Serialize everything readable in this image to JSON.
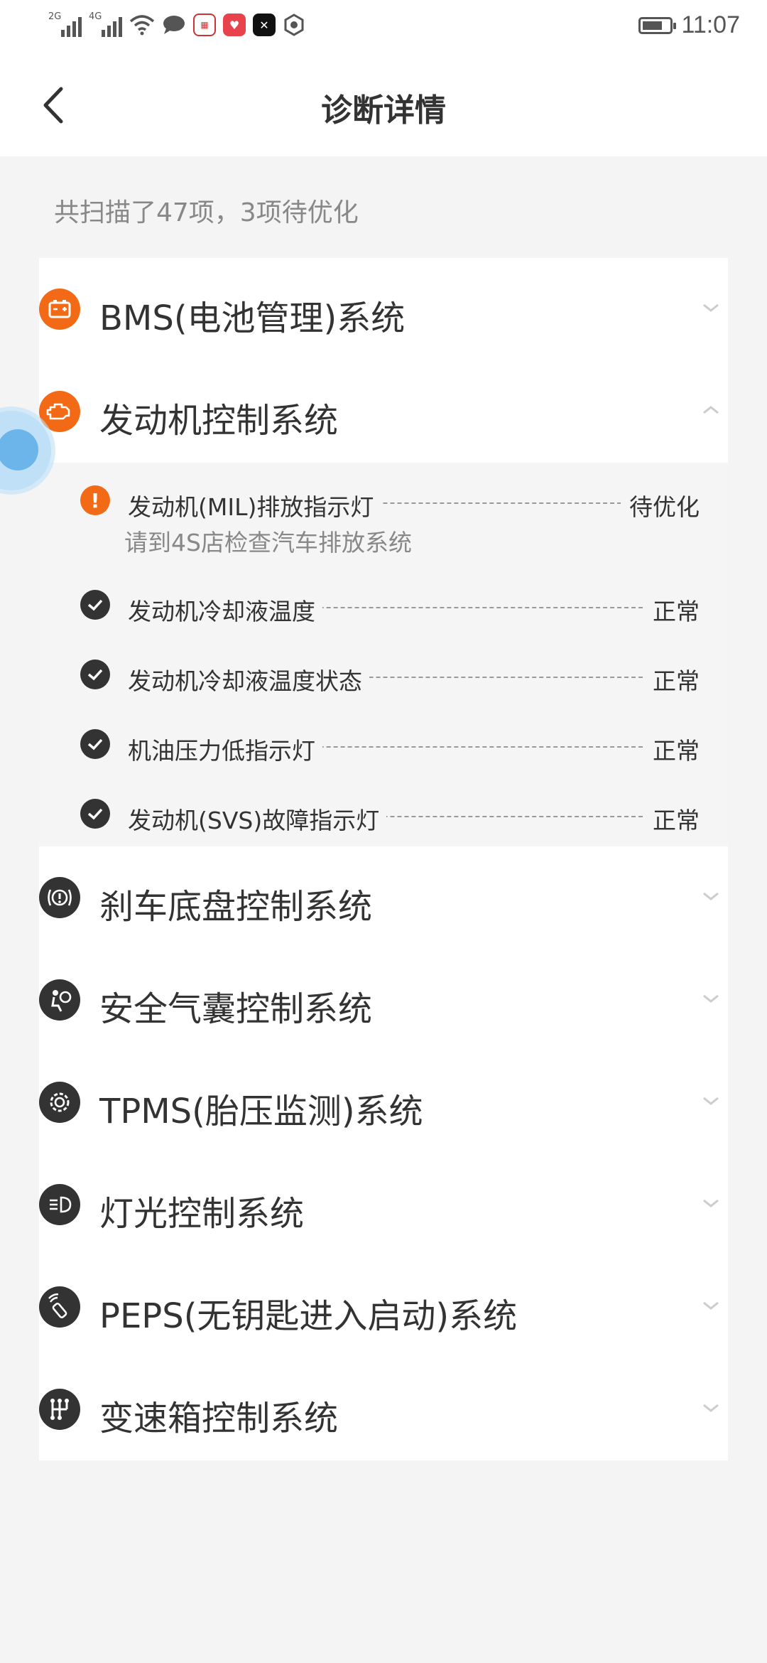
{
  "status_bar": {
    "net1": "2G",
    "net2": "4G",
    "time": "11:07",
    "battery_level": 0.75,
    "app_icons": [
      "wifi-icon",
      "chat-icon",
      "app-icon-1",
      "app-icon-2",
      "app-icon-3",
      "app-icon-4"
    ]
  },
  "header": {
    "title": "诊断详情"
  },
  "summary": "共扫描了47项，3项待优化",
  "systems": [
    {
      "label": "BMS(电池管理)系统",
      "icon": "battery-icon",
      "expanded": false
    },
    {
      "label": "发动机控制系统",
      "icon": "engine-icon",
      "expanded": true
    },
    {
      "label": "刹车底盘控制系统",
      "icon": "brake-icon",
      "expanded": false
    },
    {
      "label": "安全气囊控制系统",
      "icon": "airbag-icon",
      "expanded": false
    },
    {
      "label": "TPMS(胎压监测)系统",
      "icon": "tire-pressure-icon",
      "expanded": false
    },
    {
      "label": "灯光控制系统",
      "icon": "headlight-icon",
      "expanded": false
    },
    {
      "label": "PEPS(无钥匙进入启动)系统",
      "icon": "key-icon",
      "expanded": false
    },
    {
      "label": "变速箱控制系统",
      "icon": "gearbox-icon",
      "expanded": false
    }
  ],
  "engine_items": [
    {
      "name": "发动机(MIL)排放指示灯",
      "state": "待优化",
      "status": "warn",
      "hint": "请到4S店检查汽车排放系统"
    },
    {
      "name": "发动机冷却液温度",
      "state": "正常",
      "status": "ok"
    },
    {
      "name": "发动机冷却液温度状态",
      "state": "正常",
      "status": "ok"
    },
    {
      "name": "机油压力低指示灯",
      "state": "正常",
      "status": "ok"
    },
    {
      "name": "发动机(SVS)故障指示灯",
      "state": "正常",
      "status": "ok"
    }
  ],
  "colors": {
    "accent": "#f26a16",
    "icon_dark": "#333333",
    "background": "#f4f4f4"
  }
}
